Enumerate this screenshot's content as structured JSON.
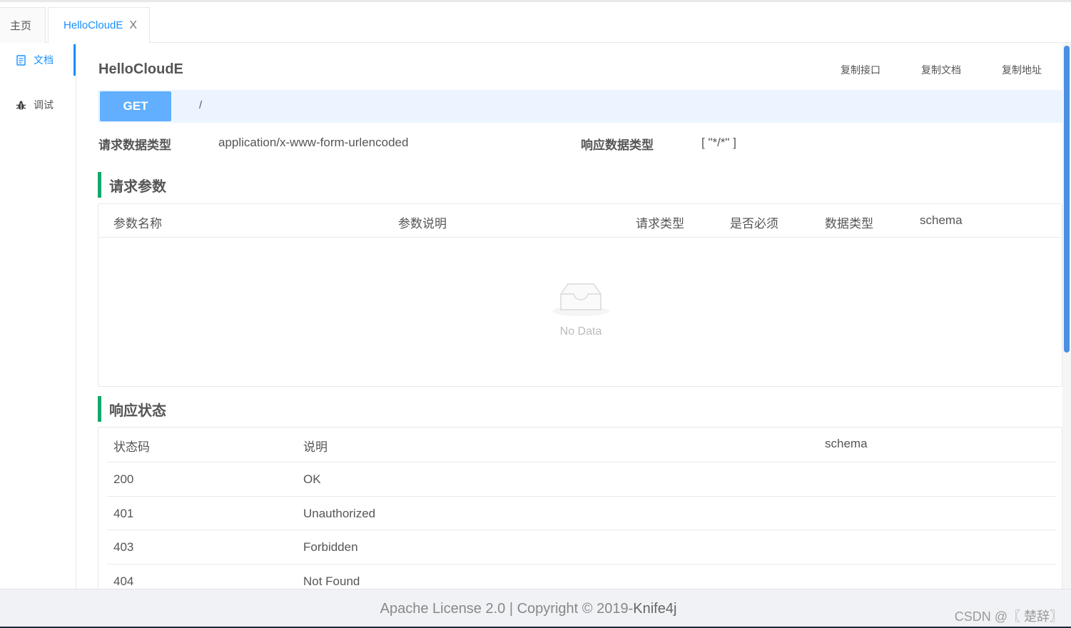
{
  "tabs": {
    "home_label": "主页",
    "active_label": "HelloCloudE",
    "close_glyph": "X"
  },
  "sidebar": {
    "items": [
      {
        "label": "文档",
        "icon": "document-icon"
      },
      {
        "label": "调试",
        "icon": "bug-icon"
      }
    ]
  },
  "api": {
    "title": "HelloCloudE",
    "copy_api_label": "复制接口",
    "copy_doc_label": "复制文档",
    "copy_url_label": "复制地址",
    "method": "GET",
    "path": "/",
    "request_type_label": "请求数据类型",
    "request_type_value": "application/x-www-form-urlencoded",
    "response_type_label": "响应数据类型",
    "response_type_value": "[ \"*/*\" ]"
  },
  "params_section": {
    "title": "请求参数",
    "columns": [
      "参数名称",
      "参数说明",
      "请求类型",
      "是否必须",
      "数据类型",
      "schema"
    ],
    "empty_text": "No Data"
  },
  "response_section": {
    "title": "响应状态",
    "columns": [
      "状态码",
      "说明",
      "schema"
    ],
    "rows": [
      {
        "code": "200",
        "desc": "OK"
      },
      {
        "code": "401",
        "desc": "Unauthorized"
      },
      {
        "code": "403",
        "desc": "Forbidden"
      },
      {
        "code": "404",
        "desc": "Not Found"
      }
    ]
  },
  "footer": {
    "text_prefix": "Apache License 2.0 | Copyright ",
    "copyright_symbol": "©",
    "text_year": " 2019-",
    "brand": "Knife4j",
    "watermark": "CSDN @〖 楚辞〗"
  },
  "colors": {
    "accent": "#1890ff",
    "get_method": "#61affe",
    "section_bar": "#13a76c",
    "scrollbar": "#4a90e2"
  }
}
